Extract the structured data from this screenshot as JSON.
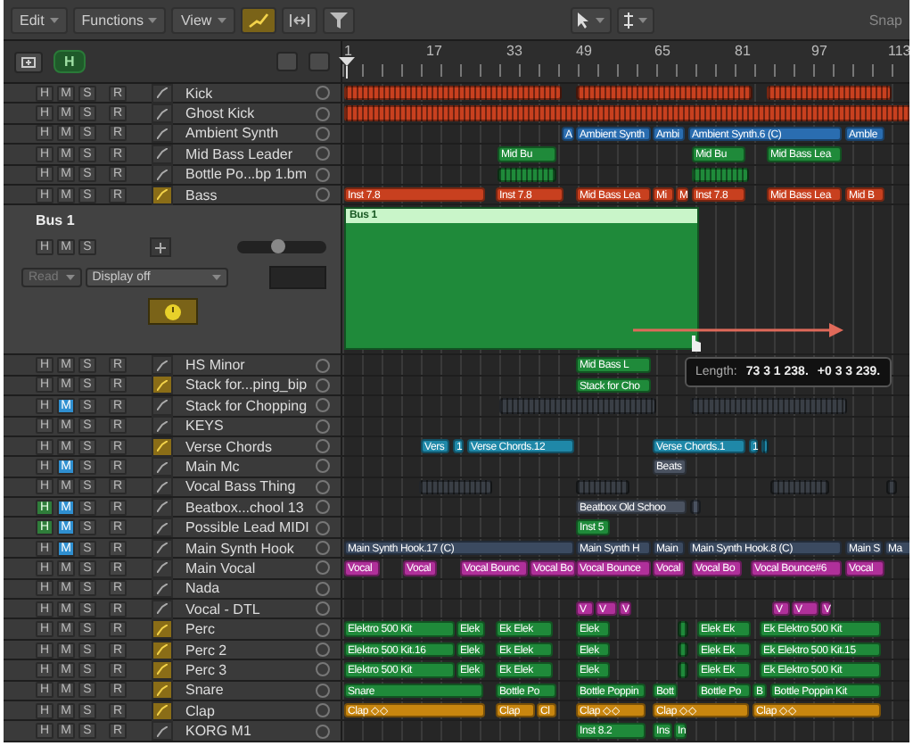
{
  "toolbar": {
    "menus": [
      "Edit",
      "Functions",
      "View"
    ],
    "snap_label": "Snap"
  },
  "header": {
    "hide_button": "H",
    "ruler": [
      "1",
      "17",
      "33",
      "49",
      "65",
      "81",
      "97",
      "113"
    ]
  },
  "tracks": [
    {
      "kind": "track",
      "name": "Kick",
      "icon_active": false,
      "buttons": [
        {
          "label": "H",
          "on": false
        },
        {
          "label": "M",
          "on": false
        },
        {
          "label": "S",
          "on": false
        },
        {
          "label": "R",
          "on": false
        }
      ],
      "regions": [
        {
          "kind": "pattern",
          "color": "#c8401f"
        },
        {
          "kind": "pattern",
          "color": "#c8401f"
        },
        {
          "kind": "pattern",
          "color": "#c8401f"
        }
      ]
    },
    {
      "kind": "track",
      "name": "Ghost Kick",
      "icon_active": false,
      "buttons": [
        {
          "label": "H",
          "on": false
        },
        {
          "label": "M",
          "on": false
        },
        {
          "label": "S",
          "on": false
        },
        {
          "label": "R",
          "on": false
        }
      ],
      "regions": [
        {
          "kind": "pattern",
          "color": "#c8401f"
        }
      ]
    },
    {
      "kind": "track",
      "name": "Ambient Synth",
      "icon_active": false,
      "buttons": [
        {
          "label": "H",
          "on": false
        },
        {
          "label": "M",
          "on": false
        },
        {
          "label": "S",
          "on": false
        },
        {
          "label": "R",
          "on": false
        }
      ],
      "regions": [
        {
          "kind": "label",
          "label": "A",
          "color": "#2a6db0"
        },
        {
          "kind": "label",
          "label": "Ambient Synth",
          "color": "#2a6db0"
        },
        {
          "kind": "label",
          "label": "Ambi",
          "color": "#2a6db0"
        },
        {
          "kind": "label",
          "label": "Ambient Synth.6 (C)",
          "color": "#2a6db0"
        },
        {
          "kind": "label",
          "label": "Amble",
          "color": "#2a6db0"
        }
      ]
    },
    {
      "kind": "track",
      "name": "Mid Bass Leader",
      "icon_active": false,
      "buttons": [
        {
          "label": "H",
          "on": false
        },
        {
          "label": "M",
          "on": false
        },
        {
          "label": "S",
          "on": false
        },
        {
          "label": "R",
          "on": false
        }
      ],
      "regions": [
        {
          "kind": "label",
          "label": "Mid Bu",
          "color": "#1f8a3a"
        },
        {
          "kind": "label",
          "label": "Mid Bu",
          "color": "#1f8a3a"
        },
        {
          "kind": "label",
          "label": "Mid Bass Lea",
          "color": "#1f8a3a"
        }
      ]
    },
    {
      "kind": "track",
      "name": "Bottle Po...bp 1.bm",
      "icon_active": false,
      "buttons": [
        {
          "label": "H",
          "on": false
        },
        {
          "label": "M",
          "on": false
        },
        {
          "label": "S",
          "on": false
        },
        {
          "label": "R",
          "on": false
        }
      ],
      "regions": [
        {
          "kind": "pattern",
          "color": "#1f8a3a"
        },
        {
          "kind": "pattern",
          "color": "#1f8a3a"
        }
      ]
    },
    {
      "kind": "track",
      "name": "Bass",
      "icon_active": true,
      "buttons": [
        {
          "label": "H",
          "on": false
        },
        {
          "label": "M",
          "on": false
        },
        {
          "label": "S",
          "on": false
        },
        {
          "label": "R",
          "on": false
        }
      ],
      "regions": [
        {
          "kind": "label",
          "label": "Inst 7.8",
          "color": "#c8401f"
        },
        {
          "kind": "label",
          "label": "Inst 7.8",
          "color": "#c8401f"
        },
        {
          "kind": "label",
          "label": "Mid Bass Lea",
          "color": "#c8401f"
        },
        {
          "kind": "label",
          "label": "Mi",
          "color": "#c8401f"
        },
        {
          "kind": "label",
          "label": "M",
          "color": "#c8401f"
        },
        {
          "kind": "label",
          "label": "Inst 7.8",
          "color": "#c8401f"
        },
        {
          "kind": "label",
          "label": "Mid Bass Lea",
          "color": "#c8401f"
        },
        {
          "kind": "label",
          "label": "Mid B",
          "color": "#c8401f"
        }
      ]
    },
    {
      "kind": "bus",
      "name": "Bus 1",
      "buttons": [
        {
          "label": "H",
          "on": false
        },
        {
          "label": "M",
          "on": false
        },
        {
          "label": "S",
          "on": false
        }
      ],
      "volume": {
        "level": 0.45
      },
      "automation_mode": {
        "value": "Read",
        "disabled": true
      },
      "automation_param": {
        "value": "Display off"
      },
      "regions": [
        {
          "kind": "bus",
          "label": "Bus 1",
          "color": "#1f8a3a"
        }
      ],
      "tooltip": {
        "label": "Length:",
        "value": "73 3 1 238.",
        "delta": "+0 3 3 239."
      }
    },
    {
      "kind": "track",
      "name": "HS Minor",
      "icon_active": false,
      "buttons": [
        {
          "label": "H",
          "on": false
        },
        {
          "label": "M",
          "on": false
        },
        {
          "label": "S",
          "on": false
        },
        {
          "label": "R",
          "on": false
        }
      ],
      "regions": [
        {
          "kind": "label",
          "label": "Mid Bass L",
          "color": "#1f8a3a"
        }
      ]
    },
    {
      "kind": "track",
      "name": "Stack for...ping_bip",
      "icon_active": true,
      "buttons": [
        {
          "label": "H",
          "on": false
        },
        {
          "label": "M",
          "on": false
        },
        {
          "label": "S",
          "on": false
        },
        {
          "label": "R",
          "on": false
        }
      ],
      "regions": [
        {
          "kind": "label",
          "label": "Stack for Cho",
          "color": "#1f8a3a"
        }
      ]
    },
    {
      "kind": "track",
      "name": "Stack for Chopping",
      "icon_active": false,
      "buttons": [
        {
          "label": "H",
          "on": false
        },
        {
          "label": "M",
          "on": true
        },
        {
          "label": "S",
          "on": false
        },
        {
          "label": "R",
          "on": false
        }
      ],
      "regions": [
        {
          "kind": "pattern",
          "color": "#3a3f46"
        },
        {
          "kind": "pattern",
          "color": "#3a3f46"
        }
      ]
    },
    {
      "kind": "track",
      "name": "KEYS",
      "icon_active": false,
      "buttons": [
        {
          "label": "H",
          "on": false
        },
        {
          "label": "M",
          "on": false
        },
        {
          "label": "S",
          "on": false
        },
        {
          "label": "R",
          "on": false
        }
      ]
    },
    {
      "kind": "track",
      "name": "Verse Chords",
      "icon_active": true,
      "buttons": [
        {
          "label": "H",
          "on": false
        },
        {
          "label": "M",
          "on": false
        },
        {
          "label": "S",
          "on": false
        },
        {
          "label": "R",
          "on": false
        }
      ],
      "regions": [
        {
          "kind": "label",
          "label": "Vers",
          "color": "#1f88a8"
        },
        {
          "kind": "label",
          "label": "1",
          "color": "#1f88a8"
        },
        {
          "kind": "label",
          "label": "Verse Chords.12",
          "color": "#1f88a8"
        },
        {
          "kind": "label",
          "label": "Verse Chords.1",
          "color": "#1f88a8"
        },
        {
          "kind": "label",
          "label": "1",
          "color": "#1f88a8"
        },
        {
          "kind": "pattern",
          "color": "#1f88a8"
        }
      ]
    },
    {
      "kind": "track",
      "name": "Main Mc",
      "icon_active": false,
      "buttons": [
        {
          "label": "H",
          "on": false
        },
        {
          "label": "M",
          "on": true
        },
        {
          "label": "S",
          "on": false
        },
        {
          "label": "R",
          "on": false
        }
      ],
      "regions": [
        {
          "kind": "label",
          "label": "Beats",
          "color": "#4a5260"
        }
      ]
    },
    {
      "kind": "track",
      "name": "Vocal Bass Thing",
      "icon_active": false,
      "buttons": [
        {
          "label": "H",
          "on": false
        },
        {
          "label": "M",
          "on": false
        },
        {
          "label": "S",
          "on": false
        },
        {
          "label": "R",
          "on": false
        }
      ],
      "regions": [
        {
          "kind": "pattern",
          "color": "#3a3f46"
        },
        {
          "kind": "pattern",
          "color": "#3a3f46"
        },
        {
          "kind": "pattern",
          "color": "#3a3f46"
        },
        {
          "kind": "pattern",
          "color": "#3a3f46"
        }
      ]
    },
    {
      "kind": "track",
      "name": "Beatbox...chool 13",
      "icon_active": false,
      "buttons": [
        {
          "label": "H",
          "on": true
        },
        {
          "label": "M",
          "on": true
        },
        {
          "label": "S",
          "on": false
        },
        {
          "label": "R",
          "on": false
        }
      ],
      "regions": [
        {
          "kind": "label",
          "label": "Beatbox Old Schoo",
          "color": "#4a5260"
        },
        {
          "kind": "pattern",
          "color": "#4a5260"
        }
      ]
    },
    {
      "kind": "track",
      "name": "Possible Lead MIDI",
      "icon_active": false,
      "buttons": [
        {
          "label": "H",
          "on": true
        },
        {
          "label": "M",
          "on": true
        },
        {
          "label": "S",
          "on": false
        },
        {
          "label": "R",
          "on": false
        }
      ],
      "regions": [
        {
          "kind": "label",
          "label": "Inst 5",
          "color": "#1f8a3a"
        }
      ]
    },
    {
      "kind": "track",
      "name": "Main Synth Hook",
      "icon_active": false,
      "buttons": [
        {
          "label": "H",
          "on": false
        },
        {
          "label": "M",
          "on": true
        },
        {
          "label": "S",
          "on": false
        },
        {
          "label": "R",
          "on": false
        }
      ],
      "regions": [
        {
          "kind": "label",
          "label": "Main Synth Hook.17 (C)",
          "color": "#3b4a60"
        },
        {
          "kind": "label",
          "label": "Main Synth H",
          "color": "#3b4a60"
        },
        {
          "kind": "label",
          "label": "Main",
          "color": "#3b4a60"
        },
        {
          "kind": "label",
          "label": "Main Synth Hook.8 (C)",
          "color": "#3b4a60"
        },
        {
          "kind": "label",
          "label": "Main S",
          "color": "#3b4a60"
        },
        {
          "kind": "label",
          "label": "Ma",
          "color": "#3b4a60"
        }
      ]
    },
    {
      "kind": "track",
      "name": "Main Vocal",
      "icon_active": false,
      "buttons": [
        {
          "label": "H",
          "on": false
        },
        {
          "label": "M",
          "on": false
        },
        {
          "label": "S",
          "on": false
        },
        {
          "label": "R",
          "on": false
        }
      ],
      "regions": [
        {
          "kind": "label",
          "label": "Vocal",
          "color": "#b0309a"
        },
        {
          "kind": "label",
          "label": "Vocal",
          "color": "#b0309a"
        },
        {
          "kind": "label",
          "label": "Vocal Bounc",
          "color": "#b0309a"
        },
        {
          "kind": "label",
          "label": "Vocal Bo",
          "color": "#b0309a"
        },
        {
          "kind": "label",
          "label": "Vocal Bounce",
          "color": "#b0309a"
        },
        {
          "kind": "label",
          "label": "Vocal",
          "color": "#b0309a"
        },
        {
          "kind": "label",
          "label": "Vocal Bo",
          "color": "#b0309a"
        },
        {
          "kind": "label",
          "label": "Vocal Bounce#6",
          "color": "#b0309a"
        },
        {
          "kind": "label",
          "label": "Vocal",
          "color": "#b0309a"
        }
      ]
    },
    {
      "kind": "track",
      "name": "Nada",
      "icon_active": false,
      "buttons": [
        {
          "label": "H",
          "on": false
        },
        {
          "label": "M",
          "on": false
        },
        {
          "label": "S",
          "on": false
        },
        {
          "label": "R",
          "on": false
        }
      ]
    },
    {
      "kind": "track",
      "name": "Vocal - DTL",
      "icon_active": false,
      "buttons": [
        {
          "label": "H",
          "on": false
        },
        {
          "label": "M",
          "on": false
        },
        {
          "label": "S",
          "on": false
        },
        {
          "label": "R",
          "on": false
        }
      ],
      "regions": [
        {
          "kind": "label",
          "label": "V",
          "color": "#b0309a"
        },
        {
          "kind": "label",
          "label": "V",
          "color": "#b0309a"
        },
        {
          "kind": "label",
          "label": "V",
          "color": "#b0309a"
        },
        {
          "kind": "label",
          "label": "V",
          "color": "#b0309a"
        },
        {
          "kind": "label",
          "label": "V",
          "color": "#b0309a"
        },
        {
          "kind": "label",
          "label": "V",
          "color": "#b0309a"
        }
      ]
    },
    {
      "kind": "track",
      "name": "Perc",
      "icon_active": true,
      "buttons": [
        {
          "label": "H",
          "on": false
        },
        {
          "label": "M",
          "on": false
        },
        {
          "label": "S",
          "on": false
        },
        {
          "label": "R",
          "on": false
        }
      ],
      "regions": [
        {
          "kind": "label",
          "label": "Elektro 500 Kit",
          "color": "#1f8a3a"
        },
        {
          "kind": "label",
          "label": "Elek",
          "color": "#1f8a3a"
        },
        {
          "kind": "label",
          "label": "Ek Elek",
          "color": "#1f8a3a"
        },
        {
          "kind": "label",
          "label": "Elek",
          "color": "#1f8a3a"
        },
        {
          "kind": "pattern",
          "color": "#1f8a3a"
        },
        {
          "kind": "label",
          "label": "Elek Ek",
          "color": "#1f8a3a"
        },
        {
          "kind": "label",
          "label": "Ek Elektro 500 Kit",
          "color": "#1f8a3a"
        }
      ]
    },
    {
      "kind": "track",
      "name": "Perc 2",
      "icon_active": true,
      "buttons": [
        {
          "label": "H",
          "on": false
        },
        {
          "label": "M",
          "on": false
        },
        {
          "label": "S",
          "on": false
        },
        {
          "label": "R",
          "on": false
        }
      ],
      "regions": [
        {
          "kind": "label",
          "label": "Elektro 500 Kit.16",
          "color": "#1f8a3a"
        },
        {
          "kind": "label",
          "label": "Elek",
          "color": "#1f8a3a"
        },
        {
          "kind": "label",
          "label": "Ek Elek",
          "color": "#1f8a3a"
        },
        {
          "kind": "label",
          "label": "Elek",
          "color": "#1f8a3a"
        },
        {
          "kind": "pattern",
          "color": "#1f8a3a"
        },
        {
          "kind": "label",
          "label": "Elek Ek",
          "color": "#1f8a3a"
        },
        {
          "kind": "label",
          "label": "Ek Elektro 500 Kit.15",
          "color": "#1f8a3a"
        }
      ]
    },
    {
      "kind": "track",
      "name": "Perc 3",
      "icon_active": true,
      "buttons": [
        {
          "label": "H",
          "on": false
        },
        {
          "label": "M",
          "on": false
        },
        {
          "label": "S",
          "on": false
        },
        {
          "label": "R",
          "on": false
        }
      ],
      "regions": [
        {
          "kind": "label",
          "label": "Elektro 500 Kit",
          "color": "#1f8a3a"
        },
        {
          "kind": "label",
          "label": "Elek",
          "color": "#1f8a3a"
        },
        {
          "kind": "label",
          "label": "Ek Elek",
          "color": "#1f8a3a"
        },
        {
          "kind": "label",
          "label": "Elek",
          "color": "#1f8a3a"
        },
        {
          "kind": "pattern",
          "color": "#1f8a3a"
        },
        {
          "kind": "label",
          "label": "Elek Ek",
          "color": "#1f8a3a"
        },
        {
          "kind": "label",
          "label": "Ek Elektro 500 Kit",
          "color": "#1f8a3a"
        }
      ]
    },
    {
      "kind": "track",
      "name": "Snare",
      "icon_active": true,
      "buttons": [
        {
          "label": "H",
          "on": false
        },
        {
          "label": "M",
          "on": false
        },
        {
          "label": "S",
          "on": false
        },
        {
          "label": "R",
          "on": false
        }
      ],
      "regions": [
        {
          "kind": "label",
          "label": "Snare",
          "color": "#1f8a3a"
        },
        {
          "kind": "label",
          "label": "Bottle Po",
          "color": "#1f8a3a"
        },
        {
          "kind": "label",
          "label": "Bottle Poppin",
          "color": "#1f8a3a"
        },
        {
          "kind": "label",
          "label": "Bott",
          "color": "#1f8a3a"
        },
        {
          "kind": "label",
          "label": "Bottle Po",
          "color": "#1f8a3a"
        },
        {
          "kind": "label",
          "label": "B",
          "color": "#1f8a3a"
        },
        {
          "kind": "label",
          "label": "Bottle Poppin Kit",
          "color": "#1f8a3a"
        }
      ]
    },
    {
      "kind": "track",
      "name": "Clap",
      "icon_active": true,
      "buttons": [
        {
          "label": "H",
          "on": false
        },
        {
          "label": "M",
          "on": false
        },
        {
          "label": "S",
          "on": false
        },
        {
          "label": "R",
          "on": false
        }
      ],
      "regions": [
        {
          "kind": "label",
          "label": "Clap ◇◇",
          "color": "#c8860f"
        },
        {
          "kind": "label",
          "label": "Clap",
          "color": "#c8860f"
        },
        {
          "kind": "label",
          "label": "Cl",
          "color": "#c8860f"
        },
        {
          "kind": "label",
          "label": "Clap ◇◇",
          "color": "#c8860f"
        },
        {
          "kind": "label",
          "label": "Clap ◇◇",
          "color": "#c8860f"
        },
        {
          "kind": "label",
          "label": "Clap ◇◇",
          "color": "#c8860f"
        }
      ]
    },
    {
      "kind": "track",
      "name": "KORG M1",
      "icon_active": false,
      "buttons": [
        {
          "label": "H",
          "on": false
        },
        {
          "label": "M",
          "on": false
        },
        {
          "label": "S",
          "on": false
        },
        {
          "label": "R",
          "on": false
        }
      ],
      "regions": [
        {
          "kind": "label",
          "label": "Inst 8.2",
          "color": "#1f8a3a"
        },
        {
          "kind": "label",
          "label": "Ins",
          "color": "#1f8a3a"
        },
        {
          "kind": "label",
          "label": "In",
          "color": "#1f8a3a"
        }
      ]
    }
  ]
}
